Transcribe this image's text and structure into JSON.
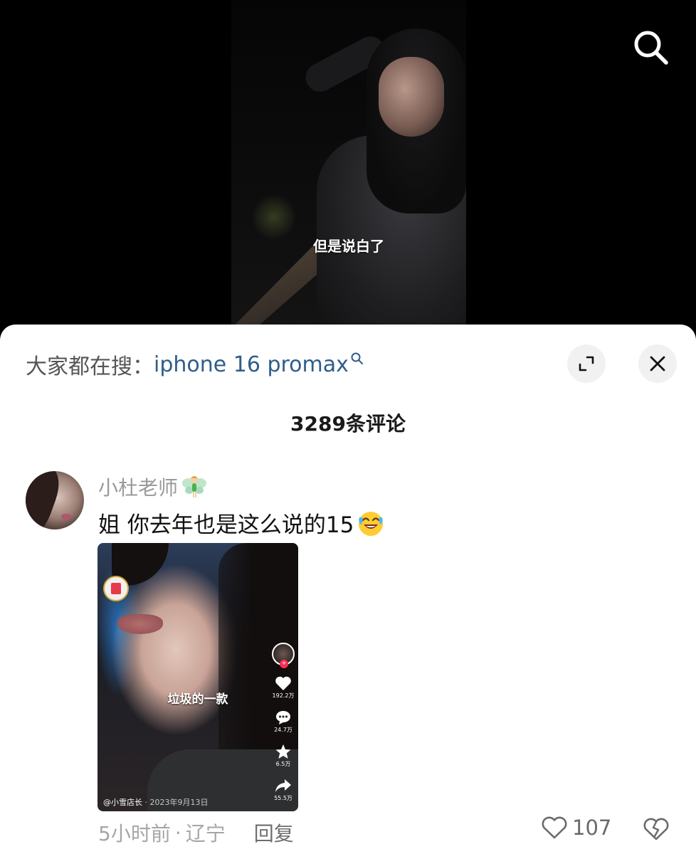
{
  "video": {
    "subtitle": "但是说白了"
  },
  "search_button": {
    "icon": "search-icon"
  },
  "sheet": {
    "trending": {
      "prefix": "大家都在搜：",
      "keyword": "iphone 16 promax",
      "keyword_color": "#2f5d8a"
    },
    "comment_count": "3289条评论"
  },
  "comment": {
    "username": "小杜老师",
    "username_badge": "fairy-emoji",
    "text": "姐 你去年也是这么说的15",
    "text_emoji": "crying-laughing-emoji",
    "time": "5小时前",
    "location": "辽宁",
    "separator": "·",
    "reply_label": "回复",
    "likes": "107",
    "attached_video": {
      "subtitle": "垃圾的一款",
      "author": "@小雪店长",
      "date": "· 2023年9月13日",
      "likes": "192.2万",
      "comments": "24.7万",
      "favorites": "6.5万",
      "shares": "55.5万"
    }
  }
}
